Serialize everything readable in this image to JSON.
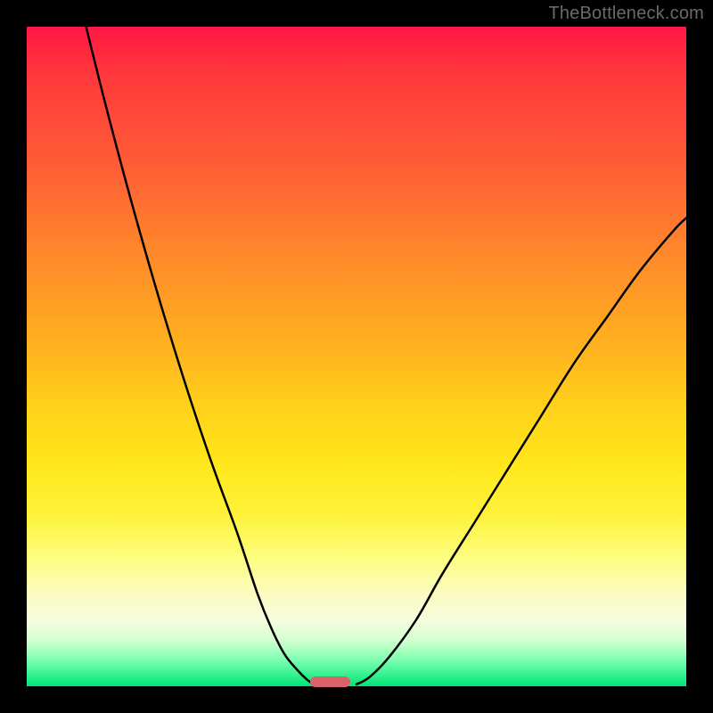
{
  "watermark": "TheBottleneck.com",
  "chart_data": {
    "type": "line",
    "title": "",
    "xlabel": "",
    "ylabel": "",
    "xlim": [
      0,
      100
    ],
    "ylim": [
      0,
      100
    ],
    "grid": false,
    "legend": false,
    "series": [
      {
        "name": "left-curve",
        "x": [
          9,
          12,
          16,
          20,
          24,
          28,
          32,
          35,
          37,
          39,
          41,
          42.5,
          43.5
        ],
        "values": [
          100,
          88,
          73,
          59,
          46,
          34,
          23,
          14,
          9,
          5,
          2.5,
          1,
          0.3
        ]
      },
      {
        "name": "right-curve",
        "x": [
          50,
          52,
          55,
          59,
          63,
          68,
          73,
          78,
          83,
          88,
          93,
          98,
          100
        ],
        "values": [
          0.3,
          1.4,
          4.5,
          10,
          17,
          25,
          33,
          41,
          49,
          56,
          63,
          69,
          71
        ]
      }
    ],
    "marker": {
      "x_center": 46,
      "width_pct": 6
    }
  }
}
